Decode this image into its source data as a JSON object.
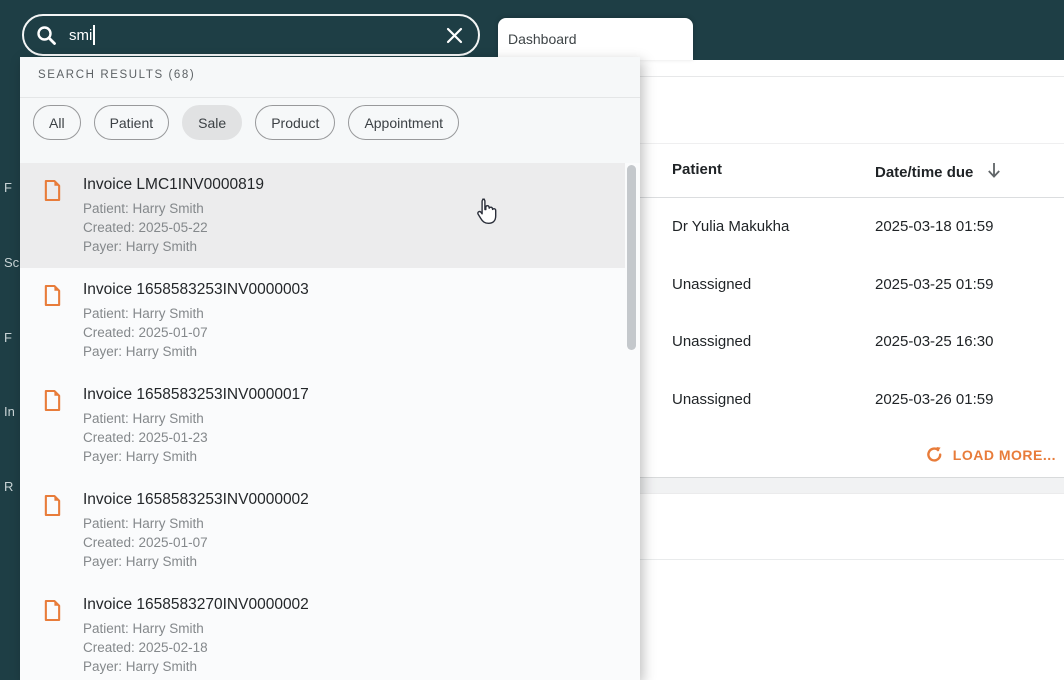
{
  "search": {
    "value": "smi"
  },
  "tab": {
    "label": "Dashboard"
  },
  "sidebar": {
    "fragments": [
      "F",
      "Sc",
      "F",
      "In",
      "R"
    ]
  },
  "panel": {
    "header": "SEARCH RESULTS (68)",
    "filters": [
      {
        "label": "All",
        "selected": false
      },
      {
        "label": "Patient",
        "selected": false
      },
      {
        "label": "Sale",
        "selected": true
      },
      {
        "label": "Product",
        "selected": false
      },
      {
        "label": "Appointment",
        "selected": false
      }
    ],
    "items": [
      {
        "title": "Invoice LMC1INV0000819",
        "patient": "Patient: Harry Smith",
        "created": "Created: 2025-05-22",
        "payer": "Payer: Harry Smith"
      },
      {
        "title": "Invoice 1658583253INV0000003",
        "patient": "Patient: Harry Smith",
        "created": "Created: 2025-01-07",
        "payer": "Payer: Harry Smith"
      },
      {
        "title": "Invoice 1658583253INV0000017",
        "patient": "Patient: Harry Smith",
        "created": "Created: 2025-01-23",
        "payer": "Payer: Harry Smith"
      },
      {
        "title": "Invoice 1658583253INV0000002",
        "patient": "Patient: Harry Smith",
        "created": "Created: 2025-01-07",
        "payer": "Payer: Harry Smith"
      },
      {
        "title": "Invoice 1658583270INV0000002",
        "patient": "Patient: Harry Smith",
        "created": "Created: 2025-02-18",
        "payer": "Payer: Harry Smith"
      }
    ]
  },
  "table": {
    "columns": {
      "patient": "Patient",
      "due": "Date/time due"
    },
    "rows": [
      {
        "patient": "Dr Yulia Makukha",
        "due": "2025-03-18 01:59"
      },
      {
        "patient": "Unassigned",
        "due": "2025-03-25 01:59"
      },
      {
        "patient": "Unassigned",
        "due": "2025-03-25 16:30"
      },
      {
        "patient": "Unassigned",
        "due": "2025-03-26 01:59"
      }
    ],
    "load_more": "LOAD MORE..."
  },
  "colors": {
    "teal": "#1e3e45",
    "orange": "#e87c3a"
  }
}
